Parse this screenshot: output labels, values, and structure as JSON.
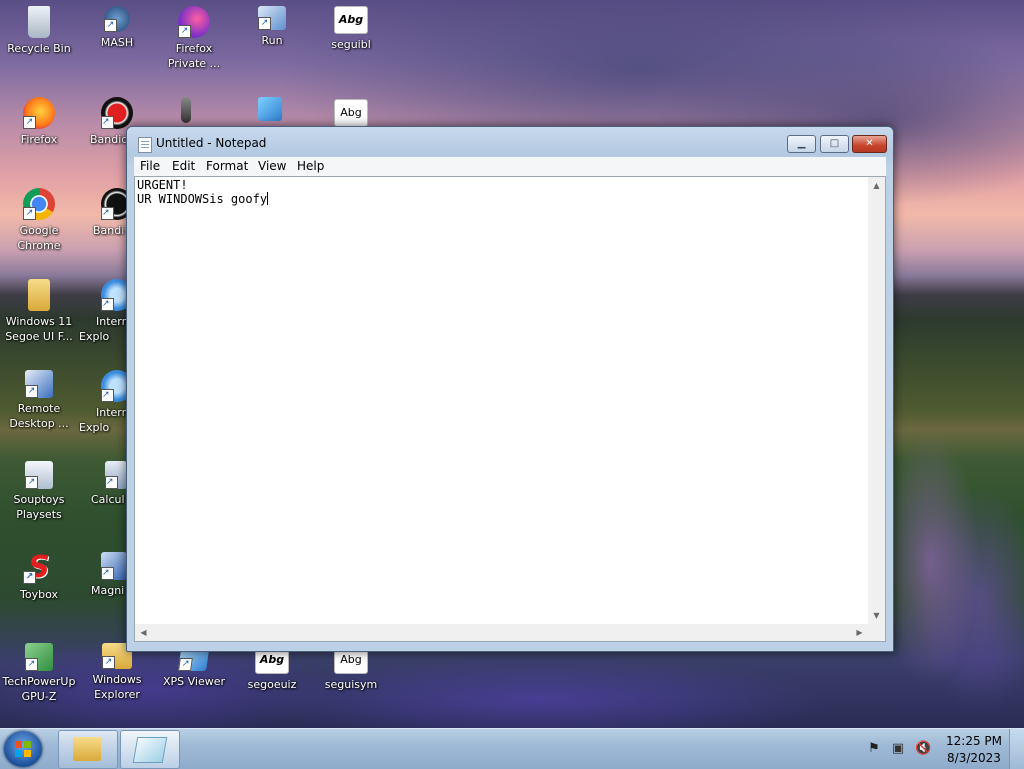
{
  "desktop_icons": [
    {
      "label": "Recycle Bin",
      "icon": "recycle-bin-icon",
      "color": "#c8d2dc"
    },
    {
      "label": "MASH",
      "icon": "mash-icon",
      "color": "#2f5f8f"
    },
    {
      "label": "Firefox Private ...",
      "icon": "firefox-private-icon",
      "color": "#7a2fc8"
    },
    {
      "label": "Run",
      "icon": "run-icon",
      "color": "#5f8fcf"
    },
    {
      "label": "seguibl",
      "icon": "font-file-icon",
      "color": "#ffffff"
    },
    {
      "label": "Firefox",
      "icon": "firefox-icon",
      "color": "#ff7a1a"
    },
    {
      "label": "Bandic",
      "icon": "bandicam-icon",
      "color": "#cc1010"
    },
    {
      "label": "Google Chrome",
      "icon": "chrome-icon",
      "color": "#db4437"
    },
    {
      "label": "Bandi",
      "icon": "bandicam-icon",
      "color": "#111111"
    },
    {
      "label": "Windows 11 Segoe UI F...",
      "icon": "folder-icon",
      "color": "#e8c15a"
    },
    {
      "label": "Intern Explo",
      "icon": "internet-explorer-icon",
      "color": "#3a8de0"
    },
    {
      "label": "Remote Desktop ...",
      "icon": "remote-desktop-icon",
      "color": "#3a6fc0"
    },
    {
      "label": "Intern Explo",
      "icon": "internet-explorer-icon",
      "color": "#3a8de0"
    },
    {
      "label": "Souptoys Playsets",
      "icon": "souptoys-icon",
      "color": "#dfe8f0"
    },
    {
      "label": "Calcul",
      "icon": "calculator-icon",
      "color": "#b8c8dc"
    },
    {
      "label": "Toybox",
      "icon": "toybox-icon",
      "color": "#e02020"
    },
    {
      "label": "Magni",
      "icon": "magnifier-icon",
      "color": "#3060b0"
    },
    {
      "label": "TechPowerUp GPU-Z",
      "icon": "gpu-z-icon",
      "color": "#2f8f3f"
    },
    {
      "label": "Windows Explorer",
      "icon": "folder-icon",
      "color": "#e8c15a"
    },
    {
      "label": "XPS Viewer",
      "icon": "xps-viewer-icon",
      "color": "#2f7fd0"
    },
    {
      "label": "segoeuiz",
      "icon": "font-file-icon",
      "color": "#ffffff"
    },
    {
      "label": "seguisym",
      "icon": "font-file-icon",
      "color": "#ffffff"
    }
  ],
  "font_preview_text": "Abg",
  "notepad": {
    "title": "Untitled - Notepad",
    "menu": [
      "File",
      "Edit",
      "Format",
      "View",
      "Help"
    ],
    "content_line1": "URGENT!",
    "content_line2": "UR WINDOWSis goofy"
  },
  "taskbar": {
    "pinned": [
      "folder-icon",
      "notepad-icon"
    ],
    "clock_time": "12:25 PM",
    "clock_date": "8/3/2023"
  },
  "accent_colors": {
    "titlebar": "#b3c9e2",
    "close_button": "#c8432c",
    "taskbar": "#9fbad6"
  }
}
